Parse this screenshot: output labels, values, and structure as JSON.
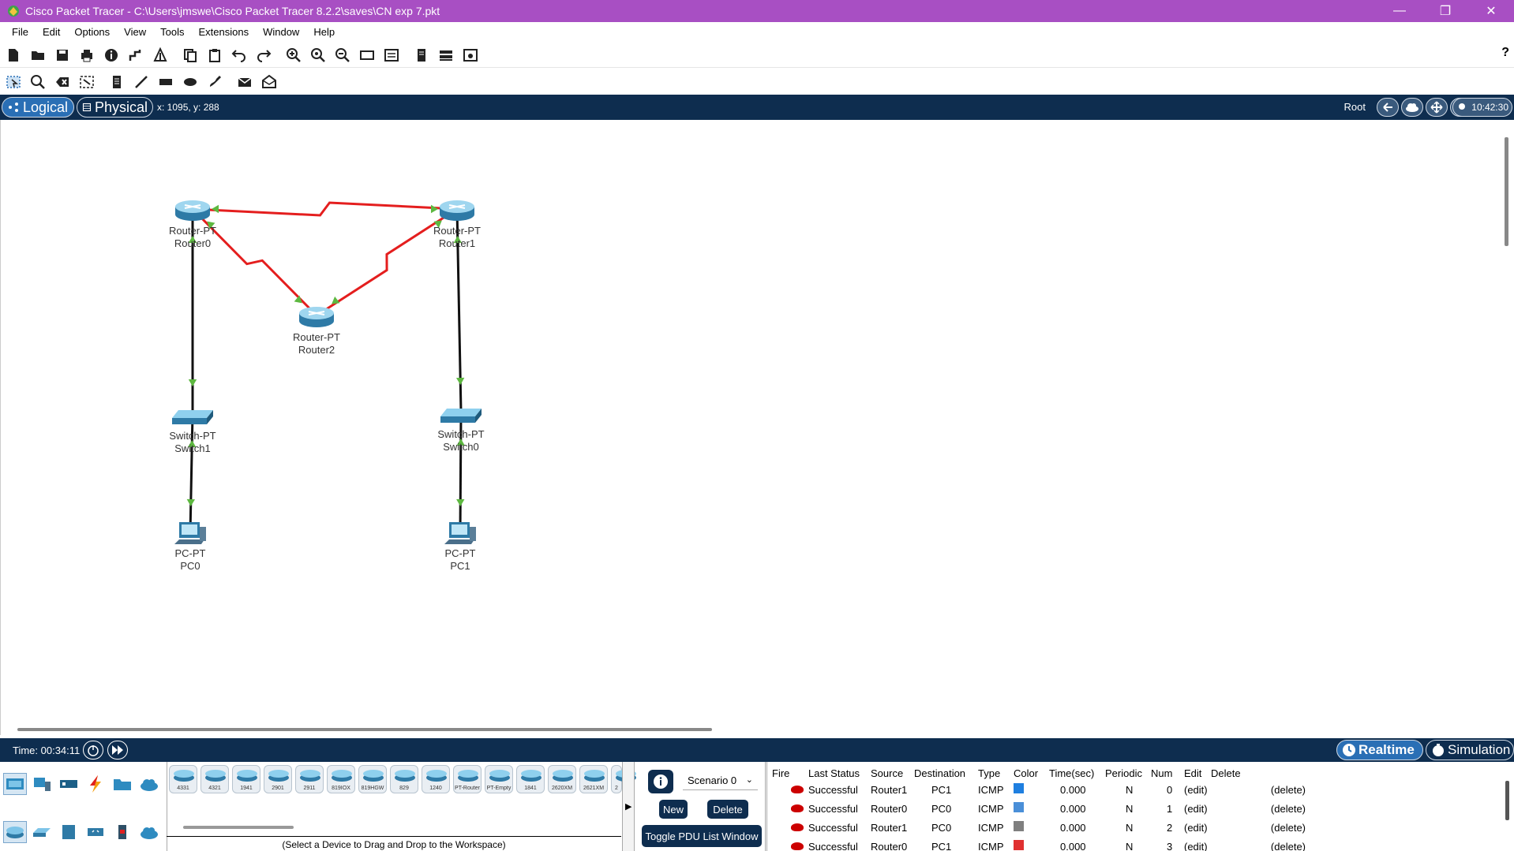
{
  "window": {
    "title": "Cisco Packet Tracer - C:\\Users\\jmswe\\Cisco Packet Tracer 8.2.2\\saves\\CN exp 7.pkt",
    "controls": [
      "—",
      "❐",
      "✕"
    ]
  },
  "menu": [
    "File",
    "Edit",
    "Options",
    "View",
    "Tools",
    "Extensions",
    "Window",
    "Help"
  ],
  "toolbar": {
    "main_icons": [
      "new-file-icon",
      "open-folder-icon",
      "save-icon",
      "print-icon",
      "info-icon",
      "activity-wizard-icon",
      "custom-device-icon",
      "copy-icon",
      "paste-icon",
      "undo-icon",
      "redo-icon",
      "zoom-in-icon",
      "zoom-reset-icon",
      "zoom-out-icon",
      "drawing-palette-icon",
      "custom-devices-dialog-icon",
      "viewport-icon",
      "network-info-icon",
      "ipc-icon"
    ],
    "help_label": "?",
    "tools_icons": [
      "select-icon",
      "inspect-icon",
      "delete-icon",
      "resize-icon",
      "note-icon",
      "draw-line-icon",
      "draw-rect-icon",
      "draw-ellipse-icon",
      "freeform-icon",
      "simple-pdu-icon",
      "complex-pdu-icon"
    ]
  },
  "modebar": {
    "logical": "Logical",
    "physical": "Physical",
    "coords": "x: 1095, y: 288",
    "root": "Root",
    "clock": "10:42:30"
  },
  "topology": {
    "devices": [
      {
        "id": "router0",
        "model": "Router-PT",
        "name": "Router0",
        "kind": "router"
      },
      {
        "id": "router1",
        "model": "Router-PT",
        "name": "Router1",
        "kind": "router"
      },
      {
        "id": "router2",
        "model": "Router-PT",
        "name": "Router2",
        "kind": "router"
      },
      {
        "id": "switch1",
        "model": "Switch-PT",
        "name": "Switch1",
        "kind": "switch"
      },
      {
        "id": "switch0",
        "model": "Switch-PT",
        "name": "Switch0",
        "kind": "switch"
      },
      {
        "id": "pc0",
        "model": "PC-PT",
        "name": "PC0",
        "kind": "pc"
      },
      {
        "id": "pc1",
        "model": "PC-PT",
        "name": "PC1",
        "kind": "pc"
      }
    ],
    "links": [
      {
        "from": "router0",
        "to": "router1",
        "type": "serial",
        "color": "#e41e1e"
      },
      {
        "from": "router0",
        "to": "router2",
        "type": "serial",
        "color": "#e41e1e"
      },
      {
        "from": "router1",
        "to": "router2",
        "type": "serial",
        "color": "#e41e1e"
      },
      {
        "from": "router0",
        "to": "switch1",
        "type": "copper",
        "color": "#111111"
      },
      {
        "from": "router1",
        "to": "switch0",
        "type": "copper",
        "color": "#111111"
      },
      {
        "from": "switch1",
        "to": "pc0",
        "type": "copper",
        "color": "#111111"
      },
      {
        "from": "switch0",
        "to": "pc1",
        "type": "copper",
        "color": "#111111"
      }
    ],
    "link_status_color": "#5db840"
  },
  "timebar": {
    "time": "Time: 00:34:11",
    "realtime": "Realtime",
    "simulation": "Simulation"
  },
  "device_panel": {
    "models": [
      "4331",
      "4321",
      "1941",
      "2901",
      "2911",
      "819IOX",
      "819HGW",
      "829",
      "1240",
      "PT-Router",
      "PT-Empty",
      "1841",
      "2620XM",
      "2621XM",
      "2"
    ],
    "hint": "(Select a Device to Drag and Drop to the Workspace)"
  },
  "scenario": {
    "selected": "Scenario 0",
    "new": "New",
    "delete": "Delete",
    "toggle": "Toggle PDU List Window"
  },
  "pdu_list": {
    "columns": [
      "Fire",
      "Last Status",
      "Source",
      "Destination",
      "Type",
      "Color",
      "Time(sec)",
      "Periodic",
      "Num",
      "Edit",
      "Delete"
    ],
    "rows": [
      {
        "status": "Successful",
        "source": "Router1",
        "destination": "PC1",
        "type": "ICMP",
        "color": "#1f7fe0",
        "time": "0.000",
        "periodic": "N",
        "num": "0",
        "edit": "(edit)",
        "delete": "(delete)"
      },
      {
        "status": "Successful",
        "source": "Router0",
        "destination": "PC0",
        "type": "ICMP",
        "color": "#4a8fd8",
        "time": "0.000",
        "periodic": "N",
        "num": "1",
        "edit": "(edit)",
        "delete": "(delete)"
      },
      {
        "status": "Successful",
        "source": "Router1",
        "destination": "PC0",
        "type": "ICMP",
        "color": "#7f7f7f",
        "time": "0.000",
        "periodic": "N",
        "num": "2",
        "edit": "(edit)",
        "delete": "(delete)"
      },
      {
        "status": "Successful",
        "source": "Router0",
        "destination": "PC1",
        "type": "ICMP",
        "color": "#e03030",
        "time": "0.000",
        "periodic": "N",
        "num": "3",
        "edit": "(edit)",
        "delete": "(delete)"
      }
    ]
  },
  "colors": {
    "titlebar": "#a84fc3",
    "navy": "#0e2d4f",
    "accent": "#2a6fb5"
  }
}
